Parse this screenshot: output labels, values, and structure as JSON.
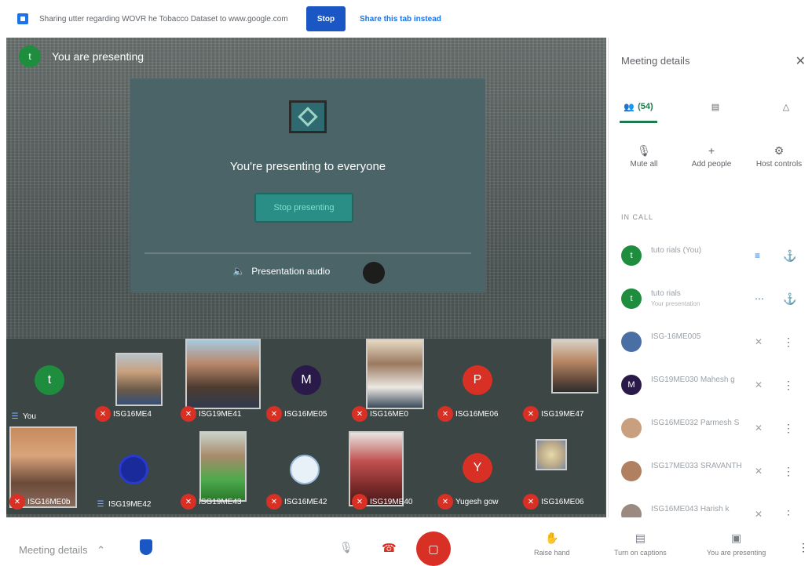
{
  "banner": {
    "share_text": "Sharing utter regarding WOVR he Tobacco Dataset to www.google.com",
    "stop_label": "Stop",
    "share_tab_label": "Share this tab instead"
  },
  "stage": {
    "presenting_label": "You are presenting",
    "presenter_initial": "t",
    "card_title": "You're presenting to everyone",
    "stop_presenting_label": "Stop presenting",
    "audio_label": "Presentation audio"
  },
  "tiles": [
    {
      "name": "You",
      "kind": "letter",
      "letter": "t",
      "color": "#1e8e3e",
      "muted": false
    },
    {
      "name": "ISG16ME4",
      "kind": "photo",
      "muted": true
    },
    {
      "name": "ISG19ME41",
      "kind": "photo",
      "muted": true
    },
    {
      "name": "ISG16ME05",
      "kind": "letter",
      "letter": "M",
      "color": "#2a1a4a",
      "muted": true
    },
    {
      "name": "ISG16ME0",
      "kind": "photo",
      "muted": true
    },
    {
      "name": "ISG16ME06",
      "kind": "letter",
      "letter": "P",
      "color": "#d93025",
      "muted": true
    },
    {
      "name": "ISG19ME47",
      "kind": "photo",
      "muted": true
    },
    {
      "name": "ISG16ME0b",
      "kind": "photo",
      "muted": true
    },
    {
      "name": "ISG19ME42",
      "kind": "avatar",
      "muted": false
    },
    {
      "name": "ISG19ME43",
      "kind": "photo",
      "muted": true
    },
    {
      "name": "ISG16ME42",
      "kind": "avatar",
      "muted": true
    },
    {
      "name": "ISG19ME40",
      "kind": "photo",
      "muted": true
    },
    {
      "name": "Yugesh gow",
      "kind": "letter",
      "letter": "Y",
      "color": "#d93025",
      "muted": true
    },
    {
      "name": "ISG16ME06",
      "kind": "photo",
      "muted": true
    }
  ],
  "panel": {
    "title": "Meeting details",
    "people_tab": "(54)",
    "actions": [
      {
        "label": "Mute all"
      },
      {
        "label": "Add people"
      },
      {
        "label": "Host controls"
      }
    ],
    "in_call": "IN CALL",
    "participants": [
      {
        "name": "tuto rials (You)",
        "sub": "",
        "initial": "t",
        "color": "#1e8e3e",
        "mic": "active"
      },
      {
        "name": "tuto rials",
        "sub": "Your presentation",
        "initial": "t",
        "color": "#1e8e3e",
        "mic": "on"
      },
      {
        "name": "ISG-16ME005",
        "sub": "",
        "initial": "",
        "color": "#4a6fa5",
        "mic": "off"
      },
      {
        "name": "ISG19ME030 Mahesh g",
        "sub": "",
        "initial": "M",
        "color": "#2a1a4a",
        "mic": "off"
      },
      {
        "name": "ISG16ME032 Parmesh S",
        "sub": "",
        "initial": "",
        "color": "#c8a080",
        "mic": "off"
      },
      {
        "name": "ISG17ME033 SRAVANTH",
        "sub": "",
        "initial": "",
        "color": "#b08060",
        "mic": "off"
      },
      {
        "name": "ISG16ME043 Harish k",
        "sub": "",
        "initial": "",
        "color": "#9a8a80",
        "mic": "off"
      }
    ]
  },
  "bottom": {
    "meeting_details": "Meeting details",
    "raise_hand": "Raise hand",
    "captions": "Turn on captions",
    "presenting": "You are presenting"
  },
  "colors": {
    "accent": "#1a73e8",
    "danger": "#d93025",
    "brand_green": "#1e8e3e"
  }
}
